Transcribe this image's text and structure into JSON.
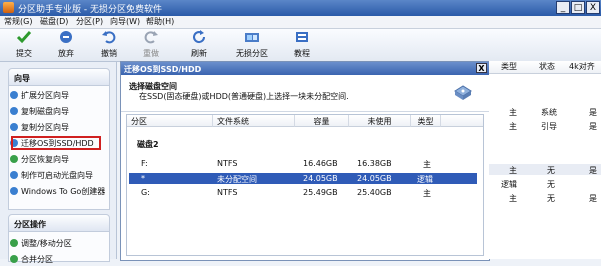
{
  "window": {
    "title": "分区助手专业版 - 无损分区免费软件",
    "minimize": "_",
    "maximize": "□",
    "close": "X"
  },
  "menu": [
    "常规(G)",
    "磁盘(D)",
    "分区(P)",
    "向导(W)",
    "帮助(H)"
  ],
  "toolbar": [
    {
      "label": "提交",
      "icon": "check-icon",
      "color": "#2e9a2e"
    },
    {
      "label": "放弃",
      "icon": "discard-icon",
      "color": "#3a6fc4"
    },
    {
      "label": "撤销",
      "icon": "undo-icon",
      "color": "#3a6fc4"
    },
    {
      "label": "重做",
      "icon": "redo-icon",
      "color": "#9aa4b4"
    },
    {
      "label": "刷新",
      "icon": "refresh-icon",
      "color": "#3a6fc4"
    },
    {
      "label": "无损分区",
      "icon": "partition-icon",
      "color": "#4a7cc8"
    },
    {
      "label": "教程",
      "icon": "tutorial-icon",
      "color": "#3a6fc4"
    }
  ],
  "left": {
    "wizard_title": "向导",
    "wizard_items": [
      {
        "label": "扩展分区向导",
        "color": "#3a7fd0"
      },
      {
        "label": "复制磁盘向导",
        "color": "#3a7fd0"
      },
      {
        "label": "复制分区向导",
        "color": "#3a7fd0"
      },
      {
        "label": "迁移OS到SSD/HDD",
        "color": "#3a7fd0"
      },
      {
        "label": "分区恢复向导",
        "color": "#39a04a"
      },
      {
        "label": "制作可启动光盘向导",
        "color": "#3a7fd0"
      },
      {
        "label": "Windows To Go创建器",
        "color": "#3a7fd0"
      }
    ],
    "ops_title": "分区操作",
    "ops_items": [
      {
        "label": "调整/移动分区",
        "color": "#39a04a"
      },
      {
        "label": "合并分区",
        "color": "#39a04a"
      }
    ]
  },
  "dialog": {
    "title": "迁移OS到SSD/HDD",
    "close": "X",
    "heading": "选择磁盘空间",
    "subheading": "在SSD(固态硬盘)或HDD(普通硬盘)上选择一块未分配空间.",
    "columns": [
      "分区",
      "文件系统",
      "容量",
      "未使用",
      "类型"
    ],
    "disk_label": "磁盘2",
    "rows": [
      {
        "part": "F:",
        "fs": "NTFS",
        "size": "16.46GB",
        "free": "16.38GB",
        "type": "主"
      },
      {
        "part": "*",
        "fs": "未分配空间",
        "size": "24.05GB",
        "free": "24.05GB",
        "type": "逻辑"
      },
      {
        "part": "G:",
        "fs": "NTFS",
        "size": "25.49GB",
        "free": "25.40GB",
        "type": "主"
      }
    ]
  },
  "right": {
    "columns": [
      "类型",
      "状态",
      "4k对齐"
    ],
    "rows": [
      {
        "type": "主",
        "status": "系统",
        "align": "是"
      },
      {
        "type": "主",
        "status": "引导",
        "align": "是"
      },
      {
        "type": "主",
        "status": "无",
        "align": "是"
      },
      {
        "type": "逻辑",
        "status": "无",
        "align": ""
      },
      {
        "type": "主",
        "status": "无",
        "align": "是"
      }
    ]
  }
}
